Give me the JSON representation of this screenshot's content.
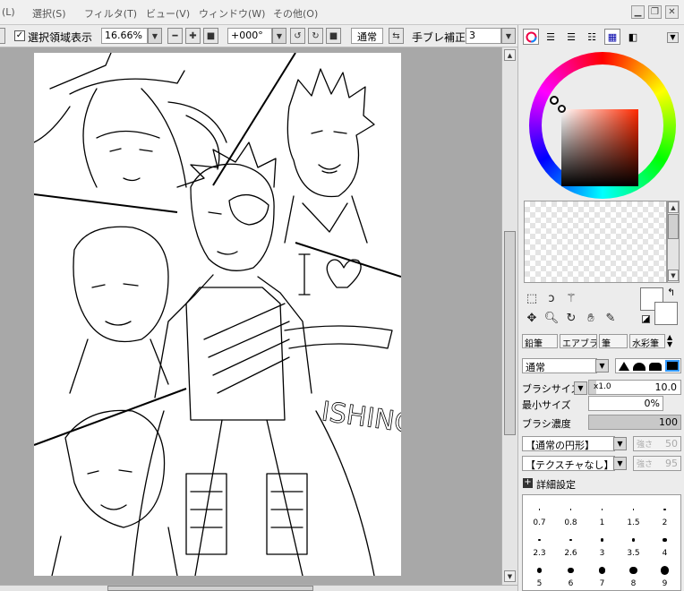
{
  "menu": {
    "items": [
      "(L)",
      "選択(S)",
      "フィルタ(T)",
      "ビュー(V)",
      "ウィンドウ(W)",
      "その他(O)"
    ]
  },
  "window_controls": [
    "minimize-icon",
    "restore-icon",
    "close-icon"
  ],
  "toolbar": {
    "show_selection_label": "選択領域表示",
    "show_selection_checked": true,
    "zoom_value": "16.66%",
    "rotation_value": "+000°",
    "blend_mode": "通常",
    "stabilizer_label": "手ブレ補正",
    "stabilizer_value": "3"
  },
  "artwork": {
    "words": [
      "I",
      "ISHINO"
    ],
    "description_icons": [
      "heart-icon"
    ]
  },
  "panel": {
    "tabs": [
      "color-wheel-icon",
      "rgb-slider-icon",
      "hsv-slider-icon",
      "palette-list-icon",
      "swatches-icon",
      "scratchpad-icon"
    ],
    "colors": {
      "current": "#ffffff",
      "secondary": "#ffffff",
      "hue_marker": "#ff5a30",
      "accent": "#000000"
    },
    "brush_tabs": [
      "鉛筆",
      "エアブラシ",
      "筆",
      "水彩筆"
    ],
    "blend_mode": "通常",
    "brush_size_label": "ブラシサイズ",
    "brush_size_multiplier": "x1.0",
    "brush_size_value": "10.0",
    "min_size_label": "最小サイズ",
    "min_size_value": "0%",
    "density_label": "ブラシ濃度",
    "density_value": "100",
    "shape_select": "【通常の円形】",
    "shape_strength_label": "強さ",
    "shape_strength_value": "50",
    "texture_select": "【テクスチャなし】",
    "texture_strength_label": "強さ",
    "texture_strength_value": "95",
    "detail_label": "詳細設定",
    "size_presets": [
      [
        "0.7",
        "0.8",
        "1",
        "1.5",
        "2"
      ],
      [
        "2.3",
        "2.6",
        "3",
        "3.5",
        "4"
      ],
      [
        "5",
        "6",
        "7",
        "8",
        "9"
      ]
    ]
  }
}
